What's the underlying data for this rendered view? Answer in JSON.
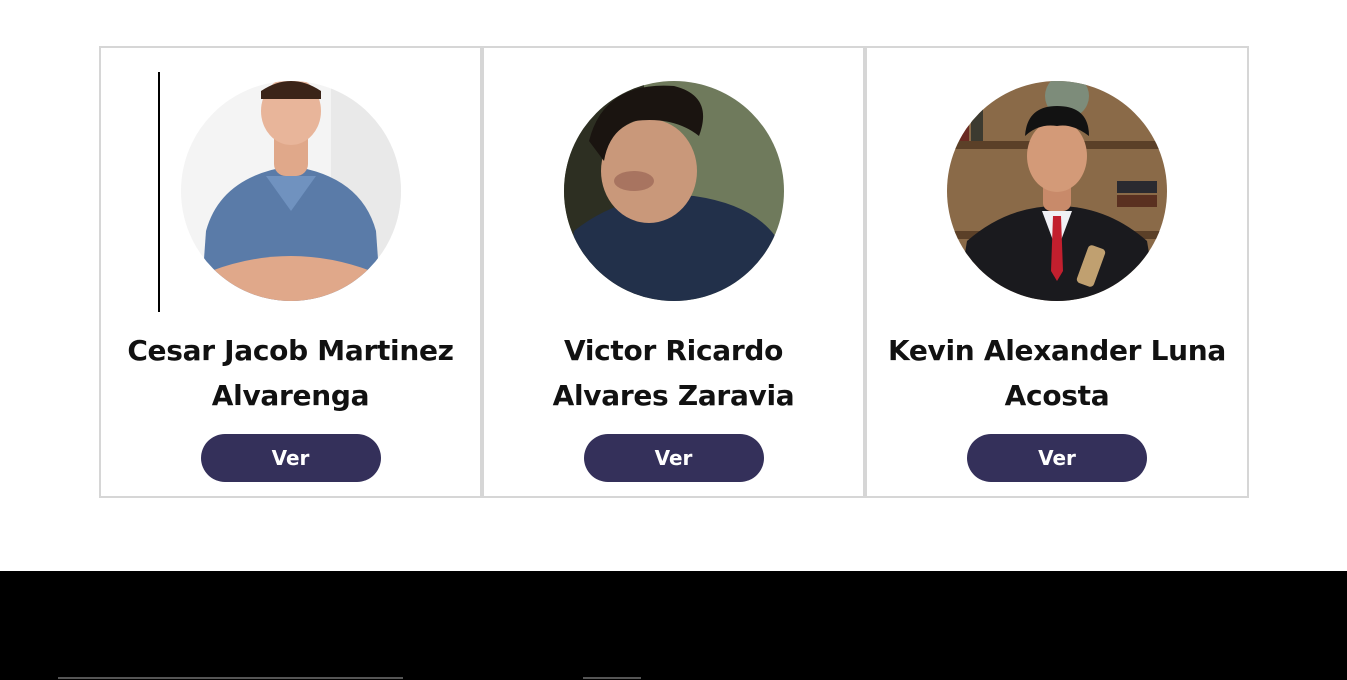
{
  "team": {
    "members": [
      {
        "name": "Cesar Jacob Martinez Alvarenga",
        "button_label": "Ver",
        "photo": "portrait-photo"
      },
      {
        "name": "Victor Ricardo Alvares Zaravia",
        "button_label": "Ver",
        "photo": "portrait-photo"
      },
      {
        "name": "Kevin Alexander Luna Acosta",
        "button_label": "Ver",
        "photo": "portrait-photo"
      }
    ]
  },
  "colors": {
    "button_bg": "#34305a",
    "card_border": "#d6d6d6",
    "footer_bg": "#000000"
  }
}
